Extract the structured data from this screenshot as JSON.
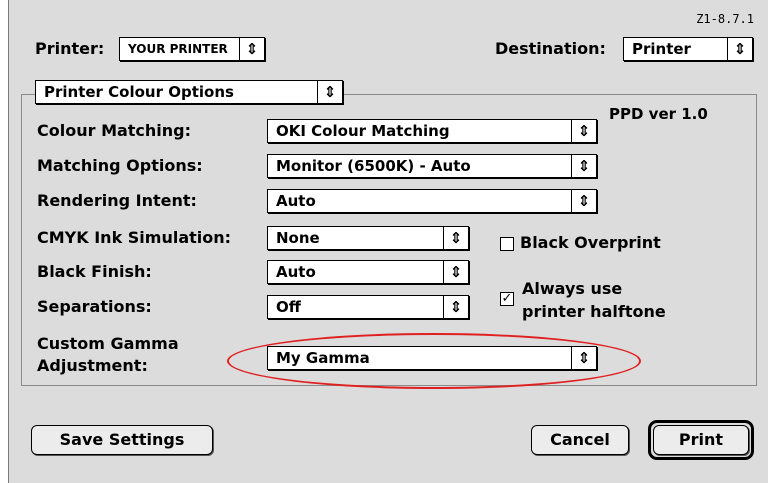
{
  "version": "Z1-8.7.1",
  "header": {
    "printer_label": "Printer:",
    "printer_value": "YOUR PRINTER",
    "destination_label": "Destination:",
    "destination_value": "Printer"
  },
  "panel_select": "Printer Colour Options",
  "ppd": "PPD ver 1.0",
  "fields": {
    "colour_matching": {
      "label": "Colour Matching:",
      "value": "OKI Colour Matching"
    },
    "matching_options": {
      "label": "Matching Options:",
      "value": "Monitor (6500K) - Auto"
    },
    "rendering_intent": {
      "label": "Rendering Intent:",
      "value": "Auto"
    },
    "cmyk_sim": {
      "label": "CMYK Ink Simulation:",
      "value": "None"
    },
    "black_finish": {
      "label": "Black Finish:",
      "value": "Auto"
    },
    "separations": {
      "label": "Separations:",
      "value": "Off"
    },
    "custom_gamma": {
      "label_line1": "Custom Gamma",
      "label_line2": "Adjustment:",
      "value": "My Gamma"
    }
  },
  "checkboxes": {
    "black_overprint": {
      "label": "Black Overprint",
      "checked": false
    },
    "halftone": {
      "label_line1": "Always use",
      "label_line2": "printer halftone",
      "checked": true
    }
  },
  "buttons": {
    "save": "Save Settings",
    "cancel": "Cancel",
    "print": "Print"
  },
  "icons": {
    "popup_arrows": "up-down-arrows-icon",
    "check": "checkmark-icon"
  },
  "colors": {
    "highlight_ellipse": "#e02020",
    "dialog_bg": "#dcdcdc"
  }
}
